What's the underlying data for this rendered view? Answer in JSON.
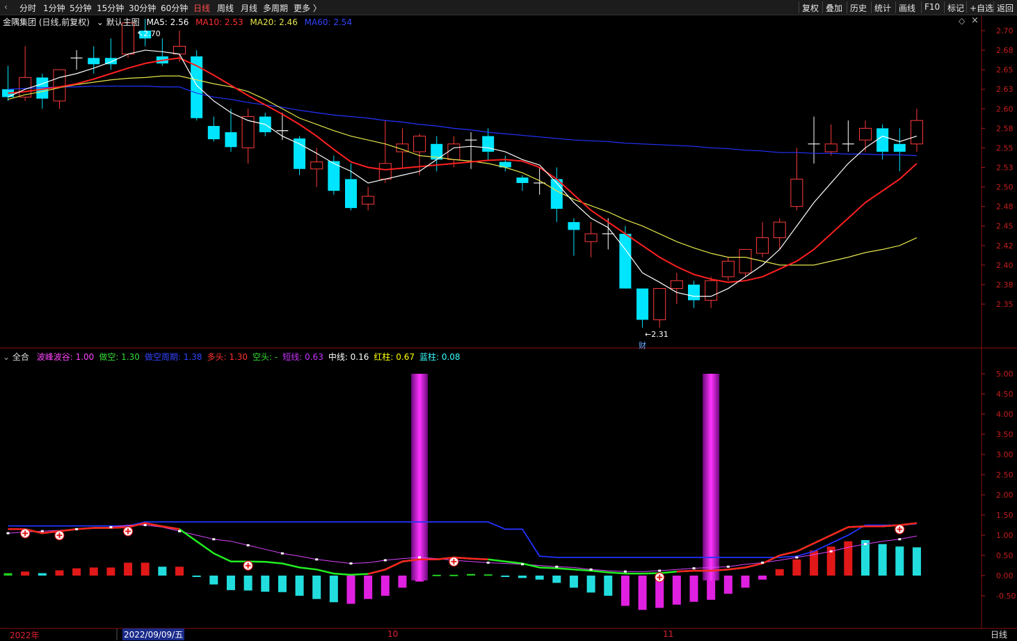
{
  "toolbar": {
    "left": [
      {
        "label": "分时"
      },
      {
        "label": "1分钟"
      },
      {
        "label": "5分钟"
      },
      {
        "label": "15分钟"
      },
      {
        "label": "30分钟"
      },
      {
        "label": "60分钟"
      },
      {
        "label": "日线",
        "active": true
      },
      {
        "label": "周线"
      },
      {
        "label": "月线"
      },
      {
        "label": "多周期"
      },
      {
        "label": "更多 〉"
      }
    ],
    "right": [
      {
        "label": "复权"
      },
      {
        "label": "叠加"
      },
      {
        "label": "历史"
      },
      {
        "label": "统计"
      },
      {
        "label": "画线"
      },
      {
        "label": "F10"
      },
      {
        "label": "标记"
      },
      {
        "label": "+自选"
      },
      {
        "label": "返回"
      }
    ],
    "collapse_icon": "chevron-left-icon"
  },
  "main_header": {
    "stock": "金隅集团 (日线,前复权)",
    "indicator": "默认主图",
    "ma5": "MA5: 2.56",
    "ma10": "MA10: 2.53",
    "ma20": "MA20: 2.46",
    "ma60": "MA60: 2.54"
  },
  "price_axis": [
    "2.70",
    "2.68",
    "2.65",
    "2.63",
    "2.60",
    "2.58",
    "2.55",
    "2.53",
    "2.50",
    "2.48",
    "2.45",
    "2.42",
    "2.40",
    "2.38",
    "2.35"
  ],
  "price_marks": {
    "high": "2.70",
    "low": "2.31",
    "cai": "财"
  },
  "sub_header": {
    "name": "全合",
    "items": [
      {
        "text": "波峰波谷: 1.00",
        "color": "#ff44ff"
      },
      {
        "text": "做空: 1.30",
        "color": "#33dd33"
      },
      {
        "text": "做空周期: 1.38",
        "color": "#3344ff"
      },
      {
        "text": "多头: 1.30",
        "color": "#ff3030"
      },
      {
        "text": "空头: -",
        "color": "#33dd33"
      },
      {
        "text": "短线: 0.63",
        "color": "#cc33ff"
      },
      {
        "text": "中线: 0.16",
        "color": "#ffffff"
      },
      {
        "text": "红柱: 0.67",
        "color": "#ffff00"
      },
      {
        "text": "蓝柱: 0.08",
        "color": "#33ffff"
      }
    ]
  },
  "sub_axis": [
    "5.00",
    "4.50",
    "4.00",
    "3.50",
    "3.00",
    "2.50",
    "2.00",
    "1.50",
    "1.00",
    "0.50",
    "0.00",
    "-0.50"
  ],
  "date_axis": {
    "year": "2022年",
    "selected": "2022/09/09/五",
    "oct": "10",
    "nov": "11",
    "period": "日线"
  },
  "colors": {
    "up": "#ff3b3b",
    "down": "#00e5ff",
    "ma5": "#ffffff",
    "ma10": "#ff2020",
    "ma20": "#e6e64c",
    "ma60": "#2233ff",
    "axis": "#c81e1e"
  },
  "chart_data": {
    "type": "candlestick",
    "candles": [
      {
        "o": 2.625,
        "h": 2.655,
        "l": 2.61,
        "c": 2.615
      },
      {
        "o": 2.615,
        "h": 2.68,
        "l": 2.61,
        "c": 2.64
      },
      {
        "o": 2.64,
        "h": 2.645,
        "l": 2.6,
        "c": 2.613
      },
      {
        "o": 2.61,
        "h": 2.65,
        "l": 2.6,
        "c": 2.65
      },
      {
        "o": 2.665,
        "h": 2.675,
        "l": 2.65,
        "c": 2.665
      },
      {
        "o": 2.665,
        "h": 2.68,
        "l": 2.645,
        "c": 2.657
      },
      {
        "o": 2.665,
        "h": 2.69,
        "l": 2.65,
        "c": 2.657
      },
      {
        "o": 2.67,
        "h": 2.71,
        "l": 2.665,
        "c": 2.71
      },
      {
        "o": 2.7,
        "h": 2.715,
        "l": 2.68,
        "c": 2.69
      },
      {
        "o": 2.667,
        "h": 2.69,
        "l": 2.655,
        "c": 2.658
      },
      {
        "o": 2.67,
        "h": 2.7,
        "l": 2.66,
        "c": 2.68
      },
      {
        "o": 2.667,
        "h": 2.675,
        "l": 2.585,
        "c": 2.588
      },
      {
        "o": 2.578,
        "h": 2.59,
        "l": 2.558,
        "c": 2.561
      },
      {
        "o": 2.57,
        "h": 2.6,
        "l": 2.545,
        "c": 2.551
      },
      {
        "o": 2.55,
        "h": 2.6,
        "l": 2.53,
        "c": 2.59
      },
      {
        "o": 2.59,
        "h": 2.595,
        "l": 2.565,
        "c": 2.57
      },
      {
        "o": 2.572,
        "h": 2.595,
        "l": 2.56,
        "c": 2.572
      },
      {
        "o": 2.562,
        "h": 2.565,
        "l": 2.515,
        "c": 2.523
      },
      {
        "o": 2.523,
        "h": 2.55,
        "l": 2.5,
        "c": 2.532
      },
      {
        "o": 2.533,
        "h": 2.54,
        "l": 2.49,
        "c": 2.495
      },
      {
        "o": 2.51,
        "h": 2.53,
        "l": 2.47,
        "c": 2.473
      },
      {
        "o": 2.478,
        "h": 2.5,
        "l": 2.47,
        "c": 2.488
      },
      {
        "o": 2.51,
        "h": 2.585,
        "l": 2.505,
        "c": 2.53
      },
      {
        "o": 2.545,
        "h": 2.575,
        "l": 2.525,
        "c": 2.555
      },
      {
        "o": 2.545,
        "h": 2.568,
        "l": 2.515,
        "c": 2.565
      },
      {
        "o": 2.555,
        "h": 2.565,
        "l": 2.52,
        "c": 2.535
      },
      {
        "o": 2.535,
        "h": 2.565,
        "l": 2.525,
        "c": 2.555
      },
      {
        "o": 2.56,
        "h": 2.57,
        "l": 2.523,
        "c": 2.56
      },
      {
        "o": 2.565,
        "h": 2.575,
        "l": 2.535,
        "c": 2.545
      },
      {
        "o": 2.532,
        "h": 2.54,
        "l": 2.52,
        "c": 2.525
      },
      {
        "o": 2.512,
        "h": 2.515,
        "l": 2.495,
        "c": 2.505
      },
      {
        "o": 2.505,
        "h": 2.525,
        "l": 2.49,
        "c": 2.505
      },
      {
        "o": 2.51,
        "h": 2.525,
        "l": 2.455,
        "c": 2.472
      },
      {
        "o": 2.455,
        "h": 2.46,
        "l": 2.412,
        "c": 2.445
      },
      {
        "o": 2.43,
        "h": 2.455,
        "l": 2.41,
        "c": 2.44
      },
      {
        "o": 2.44,
        "h": 2.46,
        "l": 2.42,
        "c": 2.44
      },
      {
        "o": 2.44,
        "h": 2.45,
        "l": 2.37,
        "c": 2.37
      },
      {
        "o": 2.37,
        "h": 2.37,
        "l": 2.32,
        "c": 2.33
      },
      {
        "o": 2.33,
        "h": 2.37,
        "l": 2.32,
        "c": 2.37
      },
      {
        "o": 2.37,
        "h": 2.39,
        "l": 2.35,
        "c": 2.38
      },
      {
        "o": 2.375,
        "h": 2.38,
        "l": 2.345,
        "c": 2.355
      },
      {
        "o": 2.355,
        "h": 2.385,
        "l": 2.345,
        "c": 2.38
      },
      {
        "o": 2.385,
        "h": 2.41,
        "l": 2.38,
        "c": 2.405
      },
      {
        "o": 2.39,
        "h": 2.42,
        "l": 2.385,
        "c": 2.42
      },
      {
        "o": 2.415,
        "h": 2.455,
        "l": 2.41,
        "c": 2.435
      },
      {
        "o": 2.435,
        "h": 2.46,
        "l": 2.42,
        "c": 2.455
      },
      {
        "o": 2.475,
        "h": 2.55,
        "l": 2.47,
        "c": 2.51
      },
      {
        "o": 2.555,
        "h": 2.59,
        "l": 2.53,
        "c": 2.555
      },
      {
        "o": 2.545,
        "h": 2.58,
        "l": 2.54,
        "c": 2.555
      },
      {
        "o": 2.555,
        "h": 2.585,
        "l": 2.545,
        "c": 2.555
      },
      {
        "o": 2.56,
        "h": 2.585,
        "l": 2.545,
        "c": 2.575
      },
      {
        "o": 2.575,
        "h": 2.58,
        "l": 2.535,
        "c": 2.545
      },
      {
        "o": 2.555,
        "h": 2.575,
        "l": 2.52,
        "c": 2.545
      },
      {
        "o": 2.555,
        "h": 2.6,
        "l": 2.545,
        "c": 2.585
      }
    ],
    "ma5": [
      2.615,
      2.625,
      2.632,
      2.64,
      2.645,
      2.652,
      2.66,
      2.67,
      2.675,
      2.673,
      2.67,
      2.63,
      2.61,
      2.595,
      2.585,
      2.58,
      2.565,
      2.555,
      2.543,
      2.53,
      2.52,
      2.505,
      2.51,
      2.515,
      2.52,
      2.535,
      2.55,
      2.552,
      2.55,
      2.545,
      2.535,
      2.528,
      2.505,
      2.48,
      2.46,
      2.448,
      2.42,
      2.39,
      2.378,
      2.365,
      2.36,
      2.36,
      2.37,
      2.385,
      2.4,
      2.42,
      2.45,
      2.48,
      2.505,
      2.53,
      2.55,
      2.565,
      2.558,
      2.565
    ],
    "ma10": [
      2.62,
      2.622,
      2.625,
      2.628,
      2.632,
      2.638,
      2.645,
      2.652,
      2.658,
      2.662,
      2.665,
      2.655,
      2.643,
      2.63,
      2.617,
      2.605,
      2.593,
      2.58,
      2.565,
      2.548,
      2.532,
      2.525,
      2.522,
      2.524,
      2.526,
      2.528,
      2.53,
      2.532,
      2.534,
      2.535,
      2.533,
      2.525,
      2.51,
      2.49,
      2.47,
      2.455,
      2.44,
      2.425,
      2.41,
      2.398,
      2.388,
      2.382,
      2.378,
      2.38,
      2.385,
      2.395,
      2.405,
      2.42,
      2.44,
      2.46,
      2.48,
      2.495,
      2.51,
      2.53
    ],
    "ma20": [
      2.612,
      2.618,
      2.622,
      2.627,
      2.631,
      2.634,
      2.637,
      2.639,
      2.64,
      2.642,
      2.642,
      2.637,
      2.632,
      2.628,
      2.622,
      2.612,
      2.6,
      2.588,
      2.58,
      2.572,
      2.565,
      2.56,
      2.555,
      2.548,
      2.54,
      2.538,
      2.535,
      2.533,
      2.53,
      2.525,
      2.518,
      2.508,
      2.495,
      2.484,
      2.476,
      2.468,
      2.458,
      2.45,
      2.44,
      2.43,
      2.422,
      2.415,
      2.41,
      2.41,
      2.405,
      2.4,
      2.4,
      2.4,
      2.405,
      2.41,
      2.416,
      2.42,
      2.425,
      2.435
    ],
    "ma60": [
      2.625,
      2.626,
      2.627,
      2.628,
      2.628,
      2.629,
      2.629,
      2.629,
      2.629,
      2.628,
      2.628,
      2.62,
      2.615,
      2.612,
      2.608,
      2.605,
      2.602,
      2.598,
      2.595,
      2.592,
      2.59,
      2.588,
      2.585,
      2.583,
      2.58,
      2.578,
      2.575,
      2.573,
      2.57,
      2.568,
      2.566,
      2.564,
      2.562,
      2.56,
      2.559,
      2.558,
      2.556,
      2.555,
      2.554,
      2.553,
      2.552,
      2.55,
      2.549,
      2.547,
      2.546,
      2.544,
      2.544,
      2.543,
      2.543,
      2.542,
      2.542,
      2.541,
      2.541,
      2.54
    ],
    "sub_bars": [
      0.06,
      0.1,
      0.06,
      0.13,
      0.18,
      0.2,
      0.2,
      0.32,
      0.32,
      0.22,
      0.22,
      -0.02,
      -0.22,
      -0.36,
      -0.37,
      -0.4,
      -0.41,
      -0.5,
      -0.58,
      -0.66,
      -0.7,
      -0.58,
      -0.5,
      -0.3,
      -0.15,
      0.02,
      0.02,
      0.04,
      0.03,
      0.0,
      -0.06,
      -0.1,
      -0.18,
      -0.3,
      -0.42,
      -0.5,
      -0.75,
      -0.85,
      -0.8,
      -0.72,
      -0.65,
      -0.6,
      -0.45,
      -0.3,
      -0.1,
      0.16,
      0.4,
      0.62,
      0.72,
      0.85,
      0.88,
      0.78,
      0.72,
      0.7
    ],
    "sub_bar_colors": [
      "g",
      "r",
      "c",
      "r",
      "r",
      "r",
      "r",
      "r",
      "r",
      "c",
      "r",
      "c",
      "c",
      "c",
      "c",
      "c",
      "c",
      "c",
      "c",
      "c",
      "m",
      "m",
      "m",
      "m",
      "m",
      "g",
      "g",
      "g",
      "g",
      "c",
      "c",
      "c",
      "c",
      "c",
      "c",
      "c",
      "m",
      "m",
      "m",
      "m",
      "m",
      "m",
      "m",
      "m",
      "m",
      "r",
      "r",
      "r",
      "r",
      "r",
      "c",
      "c",
      "c",
      "c"
    ],
    "spikes": [
      24,
      41
    ],
    "line_blue": [
      1.23,
      1.23,
      1.23,
      1.23,
      1.23,
      1.23,
      1.23,
      1.23,
      1.33,
      1.33,
      1.33,
      1.33,
      1.33,
      1.33,
      1.33,
      1.33,
      1.33,
      1.33,
      1.33,
      1.33,
      1.33,
      1.33,
      1.33,
      1.33,
      1.33,
      1.33,
      1.33,
      1.33,
      1.33,
      1.15,
      1.15,
      0.48,
      0.45,
      0.45,
      0.45,
      0.45,
      0.45,
      0.45,
      0.45,
      0.45,
      0.45,
      0.45,
      0.45,
      0.45,
      0.45,
      0.45,
      0.48,
      0.6,
      0.8,
      1.0,
      1.25,
      1.25,
      1.25,
      1.28
    ],
    "line_green": [
      1.15,
      1.15,
      1.05,
      1.1,
      1.15,
      1.18,
      1.18,
      1.2,
      1.3,
      1.22,
      1.15,
      0.85,
      0.55,
      0.35,
      0.35,
      0.34,
      0.3,
      0.2,
      0.15,
      0.05,
      0.02,
      0.04,
      0.15,
      0.35,
      0.4,
      0.4,
      0.45,
      0.42,
      0.4,
      0.35,
      0.3,
      0.2,
      0.18,
      0.15,
      0.12,
      0.08,
      0.05,
      0.05,
      0.06,
      0.1,
      0.12,
      0.12,
      0.15,
      0.2,
      0.3,
      0.5,
      0.6,
      0.8,
      1.0,
      1.2,
      1.22,
      1.22,
      1.25,
      1.3
    ],
    "line_red_segments": [
      [
        0,
        10
      ],
      [
        21,
        28
      ],
      [
        39,
        53
      ]
    ],
    "line_magenta": [
      1.05,
      1.08,
      1.1,
      1.12,
      1.15,
      1.18,
      1.2,
      1.25,
      1.25,
      1.2,
      1.1,
      1.0,
      0.9,
      0.85,
      0.75,
      0.65,
      0.55,
      0.48,
      0.4,
      0.35,
      0.3,
      0.32,
      0.38,
      0.42,
      0.45,
      0.42,
      0.38,
      0.35,
      0.32,
      0.3,
      0.28,
      0.25,
      0.22,
      0.2,
      0.15,
      0.12,
      0.1,
      0.1,
      0.12,
      0.15,
      0.18,
      0.2,
      0.22,
      0.28,
      0.32,
      0.38,
      0.45,
      0.52,
      0.6,
      0.7,
      0.78,
      0.85,
      0.9,
      0.98
    ]
  }
}
